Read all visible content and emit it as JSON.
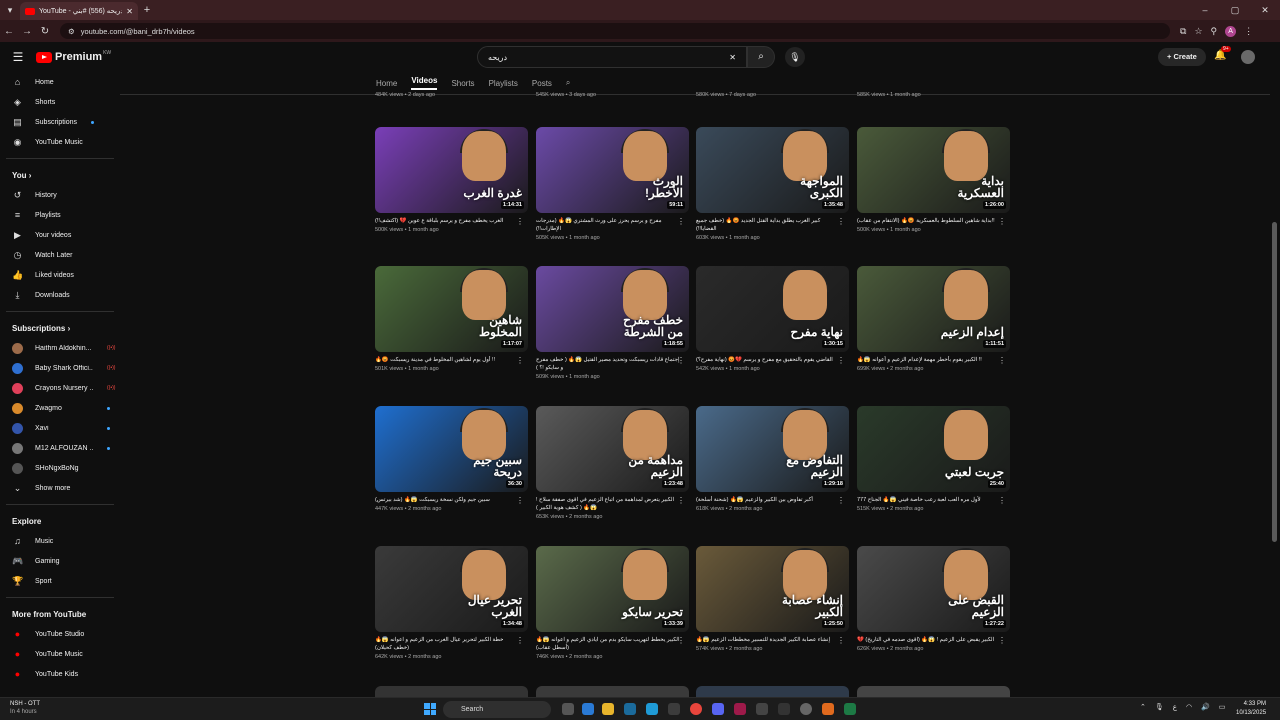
{
  "browser": {
    "tab_title": "YouTube - دريحه (556) #بني",
    "url": "youtube.com/@bani_drb7h/videos",
    "profile_initial": "A"
  },
  "header": {
    "logo_text": "Premium",
    "logo_country": "KW",
    "search_query": "دريحه",
    "create_label": "Create",
    "notif_count": "9+"
  },
  "sidebar": {
    "main": [
      {
        "label": "Home",
        "icon": "home-icon"
      },
      {
        "label": "Shorts",
        "icon": "shorts-icon"
      },
      {
        "label": "Subscriptions",
        "icon": "subscriptions-icon"
      },
      {
        "label": "YouTube Music",
        "icon": "music-icon"
      }
    ],
    "you_heading": "You",
    "you": [
      {
        "label": "History"
      },
      {
        "label": "Playlists"
      },
      {
        "label": "Your videos"
      },
      {
        "label": "Watch Later"
      },
      {
        "label": "Liked videos"
      },
      {
        "label": "Downloads"
      }
    ],
    "subs_heading": "Subscriptions",
    "subs": [
      {
        "label": "Haithm Aldokhin...",
        "color": "#9c6b4a"
      },
      {
        "label": "Baby Shark Offici...",
        "color": "#2f6fd0"
      },
      {
        "label": "Crayons Nursery ...",
        "color": "#e0405a"
      },
      {
        "label": "Zwagmo",
        "color": "#d98a2b"
      },
      {
        "label": "Xavi",
        "color": "#3355aa"
      },
      {
        "label": "M12 ALFOUZAN ...",
        "color": "#777777"
      },
      {
        "label": "SHoNgxBoNg",
        "color": "#555555"
      }
    ],
    "show_more": "Show more",
    "explore_heading": "Explore",
    "explore": [
      {
        "label": "Music"
      },
      {
        "label": "Gaming"
      },
      {
        "label": "Sport"
      }
    ],
    "more_heading": "More from YouTube",
    "more": [
      {
        "label": "YouTube Studio"
      },
      {
        "label": "YouTube Music"
      },
      {
        "label": "YouTube Kids"
      }
    ]
  },
  "channel_tabs": [
    "Home",
    "Videos",
    "Shorts",
    "Playlists",
    "Posts"
  ],
  "prev_row_meta": [
    "484K views • 2 days ago",
    "545K views • 3 days ago",
    "580K views • 7 days ago",
    "585K views • 1 month ago"
  ],
  "videos": [
    {
      "title": "الغرب يخطف مفرح و يرسم بلباقة ع عوين 💔 (اكتشف!!)",
      "meta": "500K views • 1 month ago",
      "duration": "1:14:31",
      "thumb_text": "غدرة الغرب",
      "bg": "#7a3fb8"
    },
    {
      "title": "مفرح و يرسم يحرز على ورث المشتري 😱🔥 (مدرجات الإطارات!!)",
      "meta": "505K views • 1 month ago",
      "duration": "59:11",
      "thumb_text": "الورث الأخطر!",
      "bg": "#6b4aa8"
    },
    {
      "title": "كبير الغرب يطلق بداية القتل الجديد 😡🔥 (خطف جميع القضايا!!)",
      "meta": "603K views • 1 month ago",
      "duration": "1:35:48",
      "thumb_text": "المواجهة الكبرى",
      "bg": "#3a4a5a"
    },
    {
      "title": "!!بداية شاهين السلطوط بالعسكرية 😡🔥 (الانتقام من عقاب)",
      "meta": "500K views • 1 month ago",
      "duration": "1:26:00",
      "thumb_text": "بداية العسكرية",
      "bg": "#4a5a3a"
    },
    {
      "title": "!! أول يوم لشاهين المخلوط في مدينة ريسبكت 😡🔥",
      "meta": "501K views • 1 month ago",
      "duration": "1:17:07",
      "thumb_text": "شاهين المخلوط",
      "bg": "#4a6a3a"
    },
    {
      "title": "إجتماع قادات ريسبكت وتحديد مصير القتيل 😱🔥 ( خطف مفرح و سايكو !؟ )",
      "meta": "509K views • 1 month ago",
      "duration": "1:18:55",
      "thumb_text": "خطف مفرح من الشرطة",
      "bg": "#6a4aa0"
    },
    {
      "title": "القاضي يقوم بالتحقيق مع مفرح و يرسم 💔😡 (نهاية مفرح؟)",
      "meta": "542K views • 1 month ago",
      "duration": "1:30:15",
      "thumb_text": "نهاية مفرح",
      "bg": "#2a2a2a"
    },
    {
      "title": "!! الكبير يقوم بأخطر مهمة لإعدام الزعيم و أعوانه 😱🔥",
      "meta": "699K views • 2 months ago",
      "duration": "1:11:51",
      "thumb_text": "إعدام الزعيم",
      "bg": "#4a5a3a"
    },
    {
      "title": "سبين جيم ولكن نسخة ريسبكت 😱🔥 (شد بيرتس)",
      "meta": "447K views • 2 months ago",
      "duration": "36:30",
      "thumb_text": "سبين جيم دريحة",
      "bg": "#1f6fd0"
    },
    {
      "title": "الكبير يتعرض لمداهمة من اتباع الزعيم في اقوى صفقة سلاح ! 😱🔥 ( كشف هوية الكبير )",
      "meta": "653K views • 2 months ago",
      "duration": "1:23:48",
      "thumb_text": "مداهمة من الزعيم",
      "bg": "#5a5a5a"
    },
    {
      "title": "أكبر تفاوض بين الكبير والزعيم 😱🔥 (شحنة أسلحة)",
      "meta": "618K views • 2 months ago",
      "duration": "1:29:18",
      "thumb_text": "التفاوض مع الزعيم",
      "bg": "#4a6a8a"
    },
    {
      "title": "لأول مره العب لعبة رعب خاصة فيني 😱🔥 الجناح 777",
      "meta": "515K views • 2 months ago",
      "duration": "25:40",
      "thumb_text": "جربت لعبتي",
      "bg": "#2a3a2a"
    },
    {
      "title": "خطة الكبير لتحرير عيال الغرب من الزعيم و اعوانه 😱🔥 (خطف كحيلان)",
      "meta": "642K views • 2 months ago",
      "duration": "1:34:48",
      "thumb_text": "تحرير عيال الغرب",
      "bg": "#3a3a3a"
    },
    {
      "title": "الكبير يخطط لتهريب سايكو بدم من ايادي الزعيم و اعوانه 😱🔥 (أسطل عقاب)",
      "meta": "746K views • 2 months ago",
      "duration": "1:33:39",
      "thumb_text": "تحرير سايكو",
      "bg": "#5a6a4a"
    },
    {
      "title": "إنشاء عصابة الكبير الجديدة للتسبير مخططات الزعيم 😱🔥",
      "meta": "574K views • 2 months ago",
      "duration": "1:25:50",
      "thumb_text": "إنشاء عصابة الكبير",
      "bg": "#6a5a3a"
    },
    {
      "title": "الكبير يقبض على الزعيم ! 😱🔥 (اقوى صدمه في التاريخ) 💔",
      "meta": "626K views • 2 months ago",
      "duration": "1:27:22",
      "thumb_text": "القبض على الزعيم",
      "bg": "#4a4a4a"
    }
  ],
  "taskbar": {
    "weather_title": "NSH - OTT",
    "weather_sub": "In 4 hours",
    "search_label": "Search",
    "time": "4:33 PM",
    "date": "10/13/2025"
  }
}
